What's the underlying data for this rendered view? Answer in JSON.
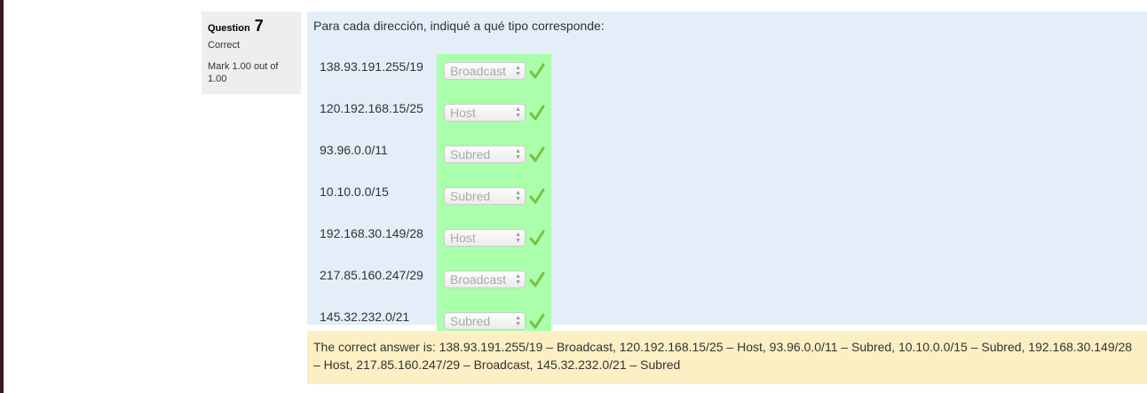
{
  "question": {
    "label": "Question",
    "number": "7",
    "state": "Correct",
    "grade": "Mark 1.00 out of 1.00",
    "text": "Para cada dirección, indiqué a qué tipo corresponde:"
  },
  "rows": [
    {
      "address": "138.93.191.255/19",
      "selected": "Broadcast",
      "result": "correct"
    },
    {
      "address": "120.192.168.15/25",
      "selected": "Host",
      "result": "correct"
    },
    {
      "address": "93.96.0.0/11",
      "selected": "Subred",
      "result": "correct"
    },
    {
      "address": "10.10.0.0/15",
      "selected": "Subred",
      "result": "correct"
    },
    {
      "address": "192.168.30.149/28",
      "selected": "Host",
      "result": "correct"
    },
    {
      "address": "217.85.160.247/29",
      "selected": "Broadcast",
      "result": "correct"
    },
    {
      "address": "145.32.232.0/21",
      "selected": "Subred",
      "result": "correct"
    }
  ],
  "feedback": {
    "right_answer": "The correct answer is: 138.93.191.255/19 – Broadcast, 120.192.168.15/25 – Host, 93.96.0.0/11 – Subred, 10.10.0.0/15 – Subred, 192.168.30.149/28 – Host, 217.85.160.247/29 – Broadcast, 145.32.232.0/21 – Subred"
  },
  "colors": {
    "info_bg": "#eeeeee",
    "formulation_bg": "#e3eef8",
    "correct_bg": "#aaffaa",
    "feedback_bg": "#fcefc4",
    "check": "#7ac142"
  },
  "icons": {
    "result_correct": "checkmark-icon",
    "select_arrows": "updown-arrows-icon"
  }
}
